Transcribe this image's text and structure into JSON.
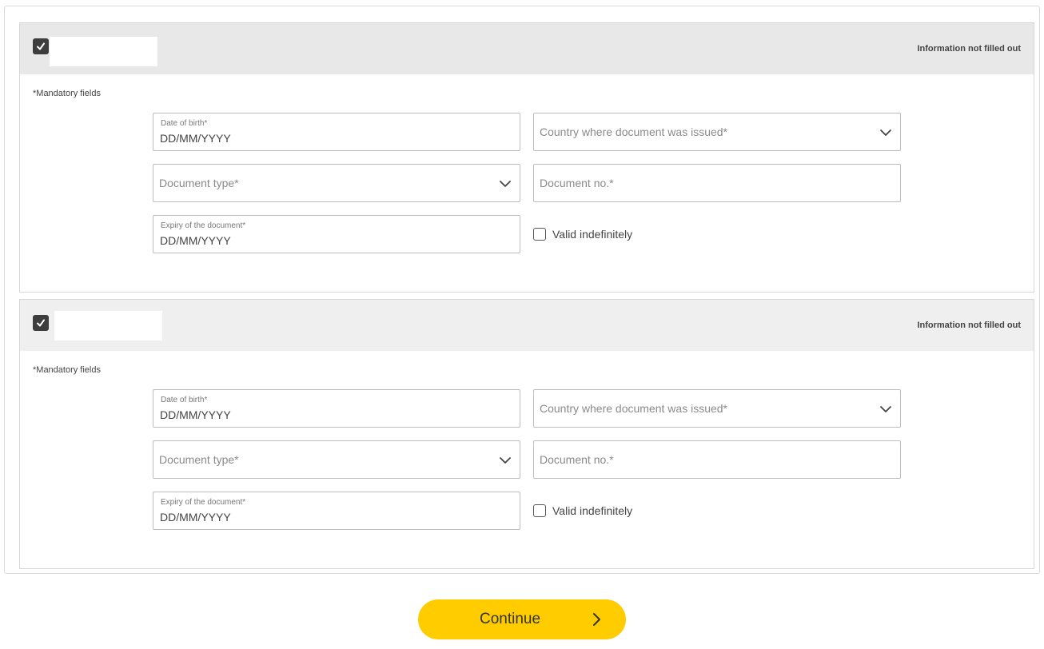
{
  "passengers": [
    {
      "status": "Information not filled out",
      "mandatory_note": "*Mandatory fields",
      "date_of_birth": {
        "label": "Date of birth*",
        "value": "DD/MM/YYYY"
      },
      "country_issued": {
        "placeholder": "Country where document was issued*"
      },
      "document_type": {
        "placeholder": "Document type*"
      },
      "document_no": {
        "placeholder": "Document no.*"
      },
      "expiry": {
        "label": "Expiry of the document*",
        "value": "DD/MM/YYYY"
      },
      "valid_indefinitely": {
        "label": "Valid indefinitely",
        "checked": false
      }
    },
    {
      "status": "Information not filled out",
      "mandatory_note": "*Mandatory fields",
      "date_of_birth": {
        "label": "Date of birth*",
        "value": "DD/MM/YYYY"
      },
      "country_issued": {
        "placeholder": "Country where document was issued*"
      },
      "document_type": {
        "placeholder": "Document type*"
      },
      "document_no": {
        "placeholder": "Document no.*"
      },
      "expiry": {
        "label": "Expiry of the document*",
        "value": "DD/MM/YYYY"
      },
      "valid_indefinitely": {
        "label": "Valid indefinitely",
        "checked": false
      }
    }
  ],
  "continue_button": {
    "label": "Continue",
    "icon": "chevron-right-icon"
  },
  "colors": {
    "accent": "#ffcc00",
    "header_bg": "#e8e8e8",
    "checkbox": "#3d3d3d"
  }
}
